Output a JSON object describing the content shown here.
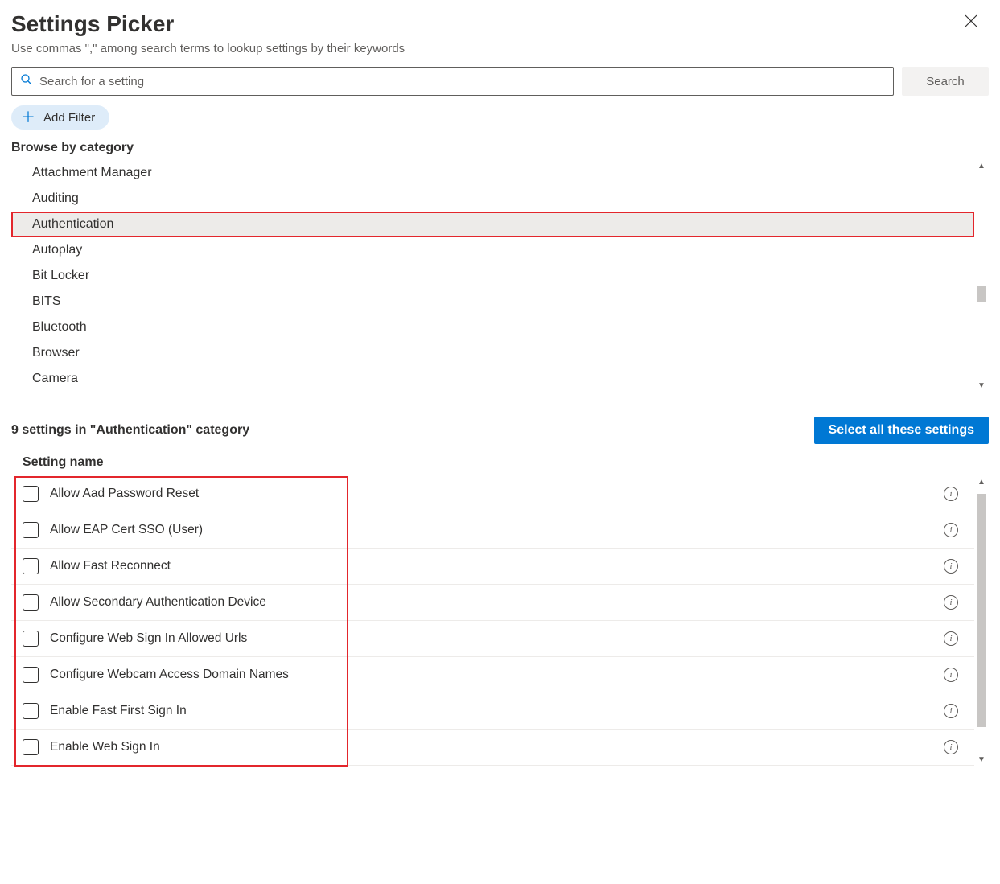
{
  "header": {
    "title": "Settings Picker",
    "subtitle": "Use commas \",\" among search terms to lookup settings by their keywords"
  },
  "search": {
    "placeholder": "Search for a setting",
    "button_label": "Search"
  },
  "add_filter_label": "Add Filter",
  "browse_label": "Browse by category",
  "categories": [
    {
      "label": "Attachment Manager",
      "selected": false
    },
    {
      "label": "Auditing",
      "selected": false
    },
    {
      "label": "Authentication",
      "selected": true
    },
    {
      "label": "Autoplay",
      "selected": false
    },
    {
      "label": "Bit Locker",
      "selected": false
    },
    {
      "label": "BITS",
      "selected": false
    },
    {
      "label": "Bluetooth",
      "selected": false
    },
    {
      "label": "Browser",
      "selected": false
    },
    {
      "label": "Camera",
      "selected": false
    }
  ],
  "results": {
    "count_text": "9 settings in \"Authentication\" category",
    "select_all_label": "Select all these settings",
    "column_header": "Setting name",
    "items": [
      {
        "label": "Allow Aad Password Reset"
      },
      {
        "label": "Allow EAP Cert SSO (User)"
      },
      {
        "label": "Allow Fast Reconnect"
      },
      {
        "label": "Allow Secondary Authentication Device"
      },
      {
        "label": "Configure Web Sign In Allowed Urls"
      },
      {
        "label": "Configure Webcam Access Domain Names"
      },
      {
        "label": "Enable Fast First Sign In"
      },
      {
        "label": "Enable Web Sign In"
      }
    ]
  }
}
